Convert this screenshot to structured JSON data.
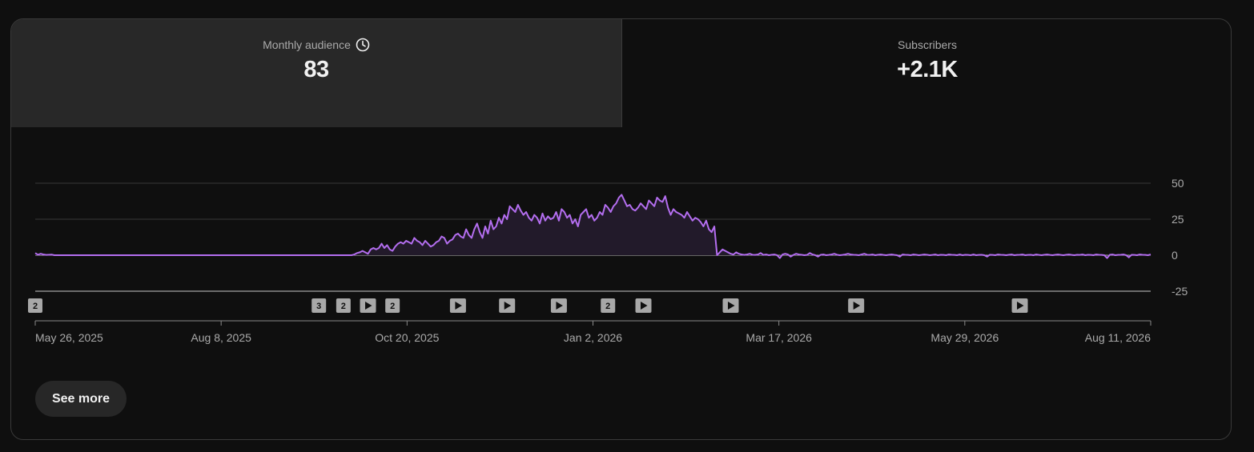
{
  "tabs": [
    {
      "label": "Monthly audience",
      "value": "83",
      "icon": "clock-icon",
      "active": true
    },
    {
      "label": "Subscribers",
      "value": "+2.1K",
      "active": false
    }
  ],
  "see_more_label": "See more",
  "colors": {
    "line": "#b46ef0",
    "fill": "#221a2a",
    "grid": "#3a3a3a",
    "zero": "#bdbdbd",
    "active_tab": "#282828",
    "background": "#0f0f0f"
  },
  "chart_data": {
    "type": "line",
    "x_ticks": [
      "May 26, 2025",
      "Aug 8, 2025",
      "Oct 20, 2025",
      "Jan 2, 2026",
      "Mar 17, 2026",
      "May 29, 2026",
      "Aug 11, 2026"
    ],
    "y_ticks": [
      50,
      25,
      0,
      -25
    ],
    "ylim": [
      -25,
      50
    ],
    "grid": true,
    "series": [
      {
        "start_date": "2025-05-26",
        "end_date": "2026-08-11",
        "values": [
          1.5,
          0.3,
          1,
          0.5,
          0.2,
          0.3,
          0.4,
          0,
          0,
          0,
          0,
          0,
          0,
          0,
          0,
          0,
          0,
          0,
          0,
          0,
          0,
          0,
          0,
          0,
          0,
          0,
          0,
          0,
          0,
          0,
          0,
          0,
          0,
          0,
          0,
          0,
          0,
          0,
          0,
          0,
          0,
          0,
          0,
          0,
          0,
          0,
          0,
          0,
          0,
          0,
          0,
          0,
          0,
          0,
          0,
          0,
          0,
          0,
          0,
          0,
          0,
          0,
          0,
          0,
          0,
          0,
          0,
          0,
          0,
          0,
          0,
          0,
          0,
          0,
          0,
          0,
          0,
          0,
          0,
          0,
          0,
          0,
          0,
          0,
          0,
          0,
          0,
          0,
          0,
          0,
          0,
          0,
          0,
          0,
          0,
          0,
          0,
          0,
          0,
          0,
          0,
          0,
          0,
          0,
          0,
          0,
          0,
          0,
          0,
          0,
          0,
          0,
          0,
          0,
          0,
          0,
          0,
          0.5,
          1.5,
          2,
          3,
          2,
          1,
          4,
          5,
          4,
          5,
          8,
          5,
          7,
          4,
          3,
          6,
          8,
          9,
          8,
          10,
          9,
          8,
          12,
          10,
          9,
          7,
          10,
          8,
          6,
          7,
          9,
          10,
          13,
          12,
          8,
          10,
          11,
          14,
          15,
          13,
          12,
          18,
          14,
          12,
          18,
          22,
          16,
          12,
          20,
          15,
          24,
          18,
          20,
          26,
          22,
          28,
          25,
          34,
          32,
          30,
          35,
          31,
          28,
          30,
          26,
          24,
          28,
          26,
          22,
          29,
          24,
          27,
          25,
          26,
          30,
          24,
          32,
          30,
          26,
          28,
          22,
          25,
          20,
          28,
          30,
          32,
          26,
          28,
          24,
          26,
          30,
          28,
          35,
          33,
          30,
          34,
          36,
          40,
          42,
          38,
          34,
          35,
          32,
          31,
          33,
          36,
          34,
          32,
          38,
          36,
          34,
          40,
          38,
          37,
          41,
          33,
          28,
          32,
          30,
          29,
          28,
          26,
          30,
          27,
          24,
          26,
          25,
          23,
          20,
          24,
          18,
          16,
          20,
          0,
          2,
          4,
          3,
          2,
          1,
          0.5,
          2,
          1,
          0.5,
          0.2,
          0.5,
          1,
          0.3,
          0.2,
          0.5,
          1.5,
          0.2,
          0.5,
          0,
          0.3,
          0.5,
          0,
          -2,
          0.5,
          1,
          0.5,
          -1,
          0.2,
          1,
          0.5,
          0.3,
          0,
          0.2,
          1.5,
          0.5,
          0,
          -1,
          0.3,
          0.5,
          0,
          0.2,
          0.5,
          1,
          0.3,
          0,
          0.2,
          0.5,
          1,
          0.5,
          0.3,
          0.2,
          0,
          0.5,
          1,
          0.3,
          0.2,
          0.5,
          0,
          0.3,
          0.5,
          0.2,
          0,
          0.3,
          0.5,
          0.2,
          0,
          -1,
          0.5,
          0.3,
          0.2,
          0,
          0.5,
          0.3,
          0,
          0.2,
          0.5,
          0.3,
          0,
          0.2,
          0.5,
          0,
          0.3,
          0.2,
          0,
          0.5,
          0.3,
          0.2,
          0,
          0.5,
          0,
          0.3,
          0.2,
          0,
          0.5,
          0,
          0.2,
          0.3,
          0,
          -1,
          0.3,
          0.2,
          0,
          0.5,
          0.3,
          0.2,
          0,
          0.3,
          0.5,
          0,
          0.2,
          0.3,
          0.5,
          0,
          0.2,
          0.3,
          0,
          0.5,
          0.2,
          0,
          0.3,
          0.5,
          0.2,
          0,
          0.3,
          0.5,
          0.2,
          0,
          0.3,
          0.5,
          0.2,
          0,
          0.3,
          0.2,
          0.5,
          0,
          0.3,
          0.2,
          0,
          0.5,
          0.3,
          0.2,
          0,
          -2,
          0.3,
          0.5,
          0,
          0.2,
          0.3,
          0.5,
          0,
          -1.5,
          0.3,
          0.2,
          0,
          0.5,
          0.3,
          0.2,
          0,
          0.5
        ]
      }
    ],
    "markers": [
      {
        "date_index": 0,
        "type": "count",
        "label": "2"
      },
      {
        "date_index": 104,
        "type": "count",
        "label": "3"
      },
      {
        "date_index": 113,
        "type": "count",
        "label": "2"
      },
      {
        "date_index": 122,
        "type": "play"
      },
      {
        "date_index": 131,
        "type": "count",
        "label": "2"
      },
      {
        "date_index": 155,
        "type": "play"
      },
      {
        "date_index": 173,
        "type": "play"
      },
      {
        "date_index": 192,
        "type": "play"
      },
      {
        "date_index": 210,
        "type": "count",
        "label": "2"
      },
      {
        "date_index": 223,
        "type": "play"
      },
      {
        "date_index": 255,
        "type": "play"
      },
      {
        "date_index": 301,
        "type": "play"
      },
      {
        "date_index": 361,
        "type": "play"
      }
    ]
  }
}
